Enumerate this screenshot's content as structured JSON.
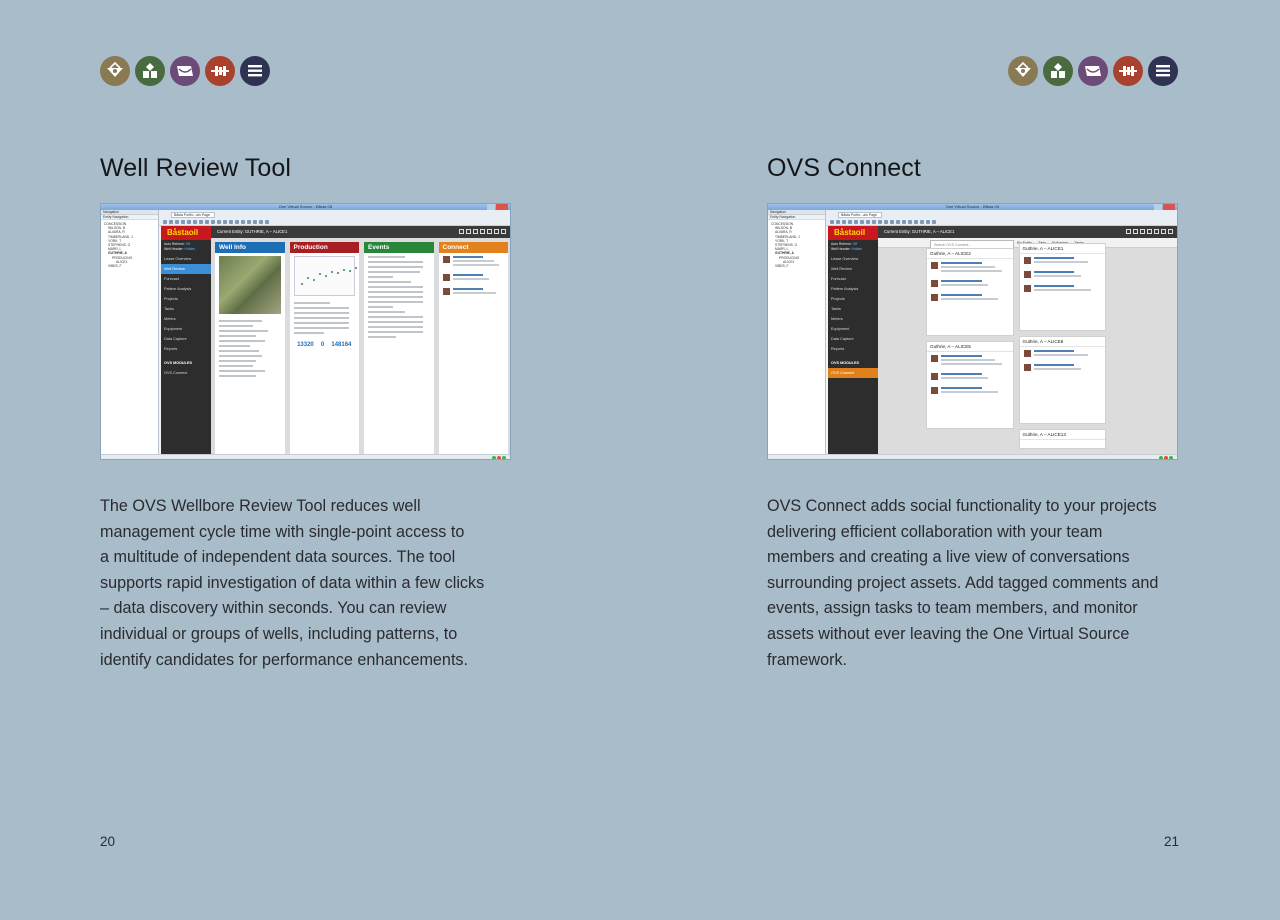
{
  "pages": [
    {
      "title": "Well Review Tool",
      "body_lines": [
        "The OVS Wellbore Review Tool reduces well",
        "management cycle time with single-point access to",
        "a multitude of independent data sources. The tool",
        "supports rapid investigation of data within a few clicks",
        "– data discovery within seconds. You can review",
        "individual or groups of wells, including patterns, to",
        "identify candidates for performance enhancements."
      ],
      "page_number": "20",
      "screenshot": {
        "window_title": "One Virtual Source - Båsta Oil",
        "tab_label": "Båsta Portfo...ain Page",
        "nav_header": "Navigation",
        "nav_subheader": "Entity Navigation",
        "tree": [
          "CONCESSION",
          "WILSON, B",
          "ALVARA, R",
          "TIMBERLAND, J",
          "YORK, T",
          "STEPHENS, G",
          "MARR, L",
          "GUTHRIE, A",
          "PRODUCING",
          "ALICE1",
          "VIBES, F"
        ],
        "brand": "Båstaoil",
        "auto_refresh_label": "Auto Refresh:",
        "auto_refresh_value": "Off",
        "well_header_label": "Well Header:",
        "well_header_value": "Hidden",
        "menu": [
          "Lease Overview",
          "Well Review",
          "Forecast",
          "Pattern Analysis",
          "Projects",
          "Tanks",
          "Meters",
          "Equipment",
          "Data Capture",
          "Reports"
        ],
        "active_menu": "Well Review",
        "modules_heading": "OVS MODULES",
        "modules": [
          "OVS Connect"
        ],
        "current_entity": "Current Entity: GUTHRIE, A – ALICE1",
        "panels": [
          "Well Info",
          "Production",
          "Events",
          "Connect"
        ],
        "production_numbers": [
          "13320",
          "0",
          "148164"
        ]
      }
    },
    {
      "title": "OVS Connect",
      "body_lines": [
        "OVS Connect adds social functionality to your projects",
        "delivering efficient collaboration with your team",
        "members and creating a live view of conversations",
        "surrounding project assets.  Add tagged comments and",
        "events, assign tasks to team members, and monitor",
        "assets without ever leaving the One Virtual Source",
        "framework."
      ],
      "page_number": "21",
      "screenshot": {
        "window_title": "One Virtual Source - Båsta Oil",
        "tab_label": "Båsta Portfo...ain Page",
        "nav_header": "Navigation",
        "nav_subheader": "Entity Navigation",
        "tree": [
          "CONCESSION",
          "WILSON, B",
          "ALVARA, R",
          "TIMBERLAND, J",
          "YORK, T",
          "STEPHENS, G",
          "MARR, L",
          "GUTHRIE, A",
          "PRODUCING",
          "ALICE1",
          "VIBES, F"
        ],
        "brand": "Båstaoil",
        "auto_refresh_label": "Auto Refresh:",
        "auto_refresh_value": "Off",
        "well_header_label": "Well Header:",
        "well_header_value": "Hidden",
        "menu": [
          "Lease Overview",
          "Well Review",
          "Forecast",
          "Pattern Analysis",
          "Projects",
          "Tanks",
          "Meters",
          "Equipment",
          "Data Capture",
          "Reports"
        ],
        "active_menu": "OVS Connect",
        "modules_heading": "OVS MODULES",
        "modules": [
          "OVS Connect"
        ],
        "current_entity": "Current Entity: GUTHRIE, A – ALICE1",
        "connect_nav": [
          "Wall",
          "My Comments",
          "By Entity",
          "Tags",
          "Following",
          "Tasks"
        ],
        "search_placeholder": "Search OVS Connect...",
        "cards": [
          "Guthrie, A – ALICE2",
          "Guthrie, A – ALICE1",
          "Guthrie, A – ALICE5",
          "Guthrie, A – ALICE8",
          "Guthrie, A – ALICE13"
        ]
      }
    }
  ],
  "icons": [
    {
      "name": "drilling-rig-icon",
      "color": "#8a7a54"
    },
    {
      "name": "facility-icon",
      "color": "#4a6a3f"
    },
    {
      "name": "document-icon",
      "color": "#6d4b79"
    },
    {
      "name": "pipeline-icon",
      "color": "#a8422f"
    },
    {
      "name": "layers-icon",
      "color": "#2e3352"
    }
  ]
}
